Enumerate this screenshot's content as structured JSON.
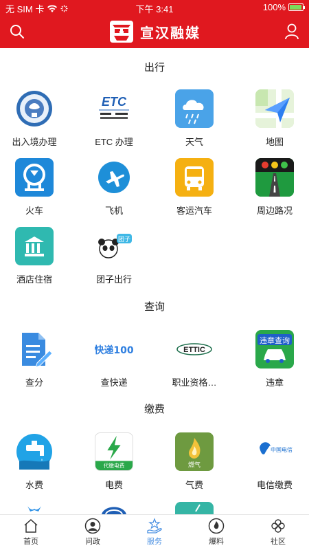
{
  "status_bar": {
    "carrier": "无 SIM 卡",
    "time": "下午 3:41",
    "battery": "100%"
  },
  "header": {
    "title": "宣汉融媒"
  },
  "sections": [
    {
      "title": "出行",
      "items": [
        {
          "label": "出入境办理"
        },
        {
          "label": "ETC 办理",
          "icon_text": "ETC"
        },
        {
          "label": "天气"
        },
        {
          "label": "地图"
        },
        {
          "label": "火车"
        },
        {
          "label": "飞机"
        },
        {
          "label": "客运汽车"
        },
        {
          "label": "周边路况"
        },
        {
          "label": "酒店住宿"
        },
        {
          "label": "团子出行",
          "icon_text": "团子"
        }
      ]
    },
    {
      "title": "查询",
      "items": [
        {
          "label": "查分"
        },
        {
          "label": "查快递",
          "icon_text": "快递100"
        },
        {
          "label": "职业资格…",
          "icon_text": "ETTIC"
        },
        {
          "label": "违章",
          "icon_text": "违章查询"
        }
      ]
    },
    {
      "title": "缴费",
      "items": [
        {
          "label": "水费"
        },
        {
          "label": "电费",
          "icon_text": "代缴电费"
        },
        {
          "label": "气费",
          "icon_text": "燃气"
        },
        {
          "label": "电信缴费",
          "icon_text": "中国电信"
        }
      ]
    }
  ],
  "tabbar": [
    {
      "label": "首页",
      "icon": "home-icon"
    },
    {
      "label": "问政",
      "icon": "person-icon"
    },
    {
      "label": "服务",
      "icon": "service-icon",
      "active": true
    },
    {
      "label": "爆料",
      "icon": "flame-icon"
    },
    {
      "label": "社区",
      "icon": "clover-icon"
    }
  ]
}
